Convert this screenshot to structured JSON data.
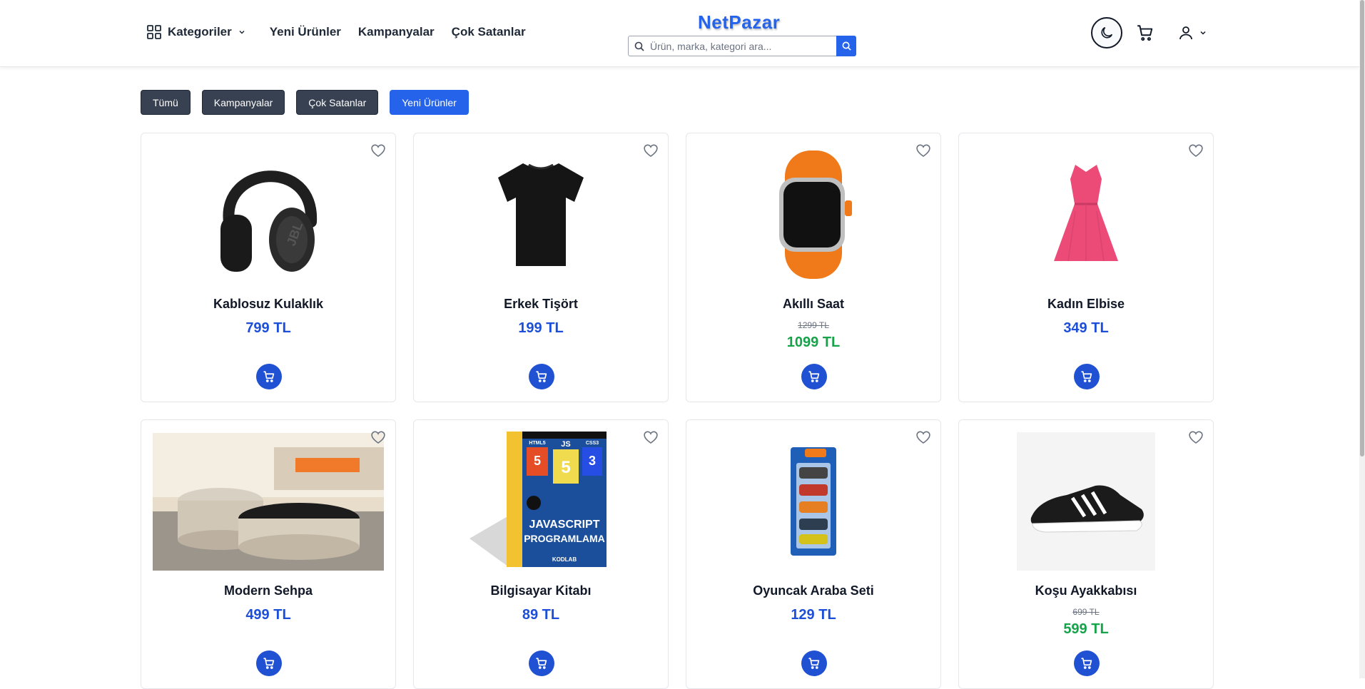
{
  "header": {
    "categories_label": "Kategoriler",
    "nav": [
      "Yeni Ürünler",
      "Kampanyalar",
      "Çok Satanlar"
    ],
    "brand": "NetPazar",
    "search_placeholder": "Ürün, marka, kategori ara..."
  },
  "filters": [
    {
      "label": "Tümü",
      "active": false
    },
    {
      "label": "Kampanyalar",
      "active": false
    },
    {
      "label": "Çok Satanlar",
      "active": false
    },
    {
      "label": "Yeni Ürünler",
      "active": true
    }
  ],
  "products": [
    {
      "name": "Kablosuz Kulaklık",
      "price": "799 TL",
      "icon": "headphones-image"
    },
    {
      "name": "Erkek Tişört",
      "price": "199 TL",
      "icon": "tshirt-image"
    },
    {
      "name": "Akıllı Saat",
      "old_price": "1299 TL",
      "sale_price": "1099 TL",
      "icon": "smartwatch-image"
    },
    {
      "name": "Kadın Elbise",
      "price": "349 TL",
      "icon": "dress-image"
    },
    {
      "name": "Modern Sehpa",
      "price": "499 TL",
      "icon": "coffee-table-image"
    },
    {
      "name": "Bilgisayar Kitabı",
      "price": "89 TL",
      "icon": "book-image"
    },
    {
      "name": "Oyuncak Araba Seti",
      "price": "129 TL",
      "icon": "toy-cars-image"
    },
    {
      "name": "Koşu Ayakkabısı",
      "old_price": "699 TL",
      "sale_price": "599 TL",
      "icon": "running-shoe-image"
    }
  ],
  "book_cover": {
    "html": "HTML5",
    "js": "JS",
    "css": "CSS3",
    "line1": "JAVASCRIPT",
    "line2": "PROGRAMLAMA",
    "publisher": "KODLAB"
  },
  "colors": {
    "accent": "#2563eb",
    "sale": "#16a34a",
    "filter_dark": "#374151"
  }
}
